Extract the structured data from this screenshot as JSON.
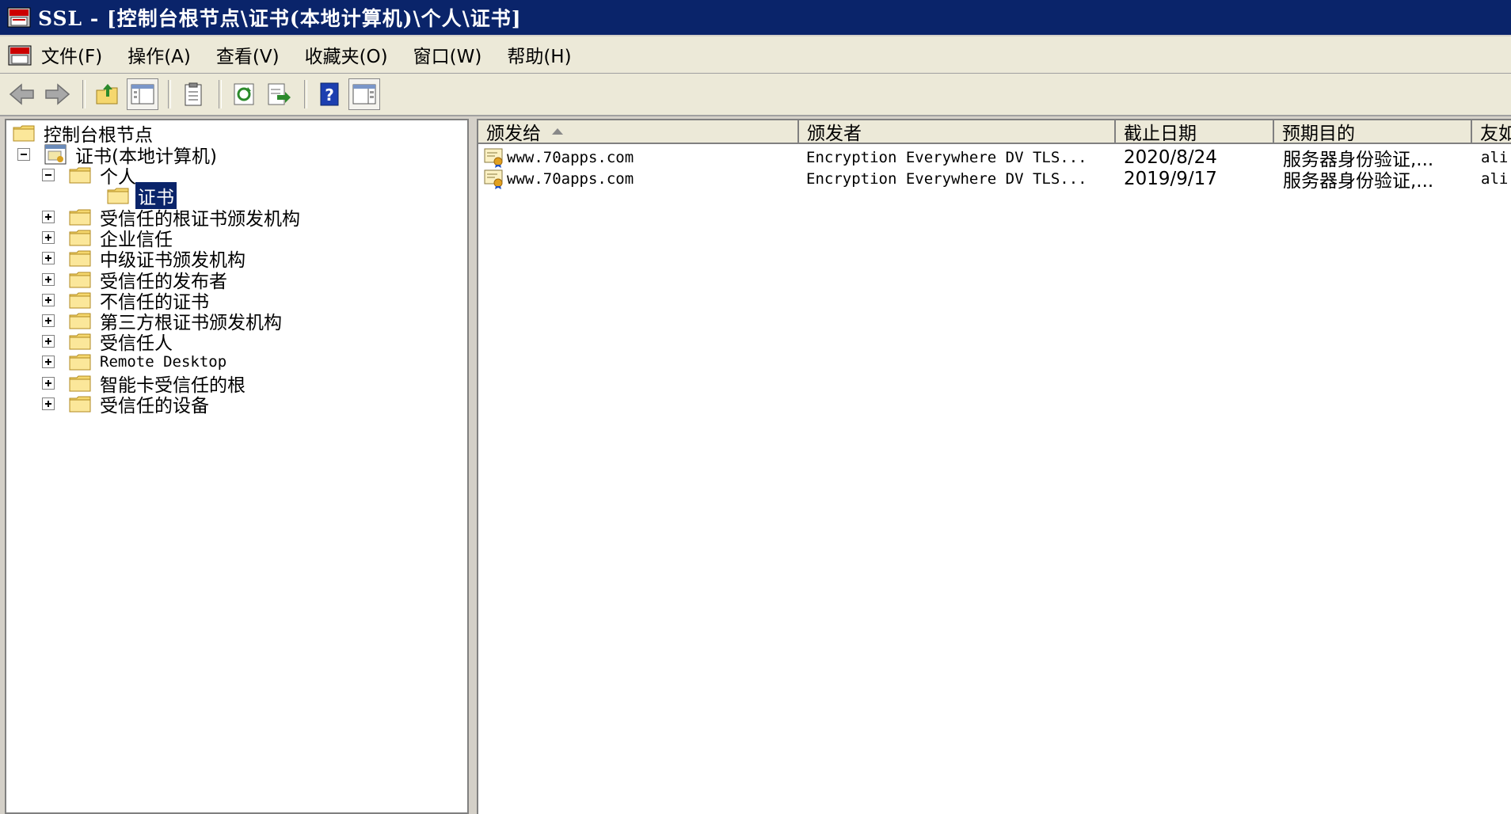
{
  "window": {
    "title": "SSL - [控制台根节点\\证书(本地计算机)\\个人\\证书]"
  },
  "menu": [
    "文件(F)",
    "操作(A)",
    "查看(V)",
    "收藏夹(O)",
    "窗口(W)",
    "帮助(H)"
  ],
  "toolbar": {
    "buttons": [
      "back-icon",
      "forward-icon",
      "up-folder-icon",
      "show-hide-tree-icon",
      "properties-icon",
      "refresh-icon",
      "export-list-icon",
      "help-icon",
      "action-pane-icon"
    ]
  },
  "tree": {
    "root": "控制台根节点",
    "certs": "证书(本地计算机)",
    "personal": "个人",
    "personal_certs": "证书",
    "stores": [
      "受信任的根证书颁发机构",
      "企业信任",
      "中级证书颁发机构",
      "受信任的发布者",
      "不信任的证书",
      "第三方根证书颁发机构",
      "受信任人",
      "Remote Desktop",
      "智能卡受信任的根",
      "受信任的设备"
    ]
  },
  "list": {
    "columns": [
      "颁发给",
      "颁发者",
      "截止日期",
      "预期目的",
      "友如"
    ],
    "rows": [
      {
        "issued_to": "www.70apps.com",
        "issued_by": "Encryption Everywhere DV TLS...",
        "expires": "2020/8/24",
        "purpose": "服务器身份验证,...",
        "friendly": "ali"
      },
      {
        "issued_to": "www.70apps.com",
        "issued_by": "Encryption Everywhere DV TLS...",
        "expires": "2019/9/17",
        "purpose": "服务器身份验证,...",
        "friendly": "ali"
      }
    ]
  },
  "colors": {
    "titlebar": "#0a246a",
    "selection": "#0a246a",
    "folder": "#f5d76e"
  }
}
